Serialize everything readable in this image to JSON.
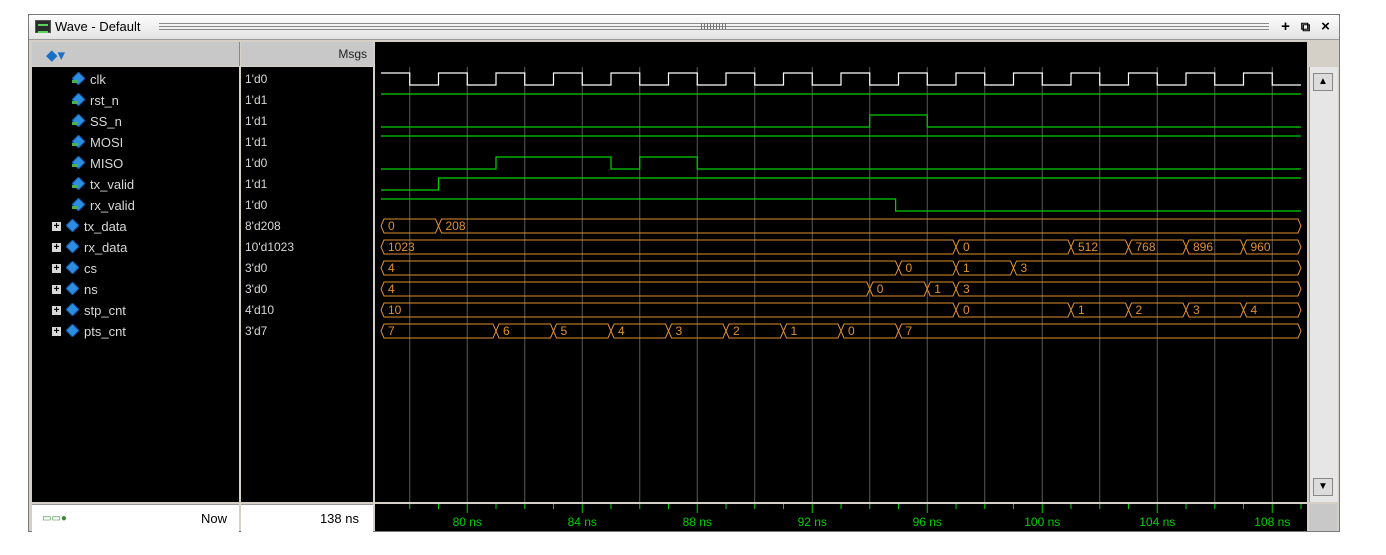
{
  "window": {
    "title": "Wave - Default"
  },
  "header": {
    "msgs_label": "Msgs"
  },
  "signals": [
    {
      "name": "clk",
      "value": "1'd0",
      "group": false
    },
    {
      "name": "rst_n",
      "value": "1'd1",
      "group": false
    },
    {
      "name": "SS_n",
      "value": "1'd1",
      "group": false
    },
    {
      "name": "MOSI",
      "value": "1'd1",
      "group": false
    },
    {
      "name": "MISO",
      "value": "1'd0",
      "group": false
    },
    {
      "name": "tx_valid",
      "value": "1'd1",
      "group": false
    },
    {
      "name": "rx_valid",
      "value": "1'd0",
      "group": false
    },
    {
      "name": "tx_data",
      "value": "8'd208",
      "group": true
    },
    {
      "name": "rx_data",
      "value": "10'd1023",
      "group": true
    },
    {
      "name": "cs",
      "value": "3'd0",
      "group": true
    },
    {
      "name": "ns",
      "value": "3'd0",
      "group": true
    },
    {
      "name": "stp_cnt",
      "value": "4'd10",
      "group": true
    },
    {
      "name": "pts_cnt",
      "value": "3'd7",
      "group": true
    }
  ],
  "waves": {
    "time_range_ns": [
      77,
      109
    ],
    "clock_period_ns": 2,
    "clock_first_rise_ns": 77,
    "digital": [
      {
        "signal": "rst_n",
        "color": "#00d000",
        "initial": 1,
        "edges": []
      },
      {
        "signal": "SS_n",
        "color": "#00d000",
        "initial": 0,
        "edges": [
          94,
          96
        ]
      },
      {
        "signal": "MOSI",
        "color": "#00d000",
        "initial": 1,
        "edges": []
      },
      {
        "signal": "MISO",
        "color": "#00d000",
        "initial": 0,
        "edges": [
          81,
          85,
          86,
          88
        ]
      },
      {
        "signal": "tx_valid",
        "color": "#00d000",
        "initial": 0,
        "edges": [
          79
        ]
      },
      {
        "signal": "rx_valid",
        "color": "#00d000",
        "initial": 1,
        "edges": [
          94.9
        ]
      }
    ],
    "buses": [
      {
        "signal": "tx_data",
        "segments": [
          {
            "t": 77,
            "v": "0"
          },
          {
            "t": 79,
            "v": "208"
          }
        ]
      },
      {
        "signal": "rx_data",
        "segments": [
          {
            "t": 77,
            "v": "1023"
          },
          {
            "t": 97,
            "v": "0"
          },
          {
            "t": 101,
            "v": "512"
          },
          {
            "t": 103,
            "v": "768"
          },
          {
            "t": 105,
            "v": "896"
          },
          {
            "t": 107,
            "v": "960"
          }
        ]
      },
      {
        "signal": "cs",
        "segments": [
          {
            "t": 77,
            "v": "4"
          },
          {
            "t": 95,
            "v": "0"
          },
          {
            "t": 97,
            "v": "1"
          },
          {
            "t": 99,
            "v": "3"
          }
        ]
      },
      {
        "signal": "ns",
        "segments": [
          {
            "t": 77,
            "v": "4"
          },
          {
            "t": 94,
            "v": "0"
          },
          {
            "t": 96,
            "v": "1"
          },
          {
            "t": 97,
            "v": "3"
          }
        ]
      },
      {
        "signal": "stp_cnt",
        "segments": [
          {
            "t": 77,
            "v": "10"
          },
          {
            "t": 97,
            "v": "0"
          },
          {
            "t": 101,
            "v": "1"
          },
          {
            "t": 103,
            "v": "2"
          },
          {
            "t": 105,
            "v": "3"
          },
          {
            "t": 107,
            "v": "4"
          }
        ]
      },
      {
        "signal": "pts_cnt",
        "segments": [
          {
            "t": 77,
            "v": "7"
          },
          {
            "t": 81,
            "v": "6"
          },
          {
            "t": 83,
            "v": "5"
          },
          {
            "t": 85,
            "v": "4"
          },
          {
            "t": 87,
            "v": "3"
          },
          {
            "t": 89,
            "v": "2"
          },
          {
            "t": 91,
            "v": "1"
          },
          {
            "t": 93,
            "v": "0"
          },
          {
            "t": 95,
            "v": "7"
          }
        ]
      }
    ],
    "colors": {
      "clock_high": "#ffffff",
      "bus": "#e09030",
      "grid": "#5a5a5a",
      "timeline_text": "#00d000"
    }
  },
  "timeline": {
    "ticks": [
      "80 ns",
      "84 ns",
      "88 ns",
      "92 ns",
      "96 ns",
      "100 ns",
      "104 ns",
      "108 ns"
    ],
    "tick_times_ns": [
      80,
      84,
      88,
      92,
      96,
      100,
      104,
      108
    ]
  },
  "status": {
    "now_label": "Now",
    "now_value": "138 ns"
  }
}
